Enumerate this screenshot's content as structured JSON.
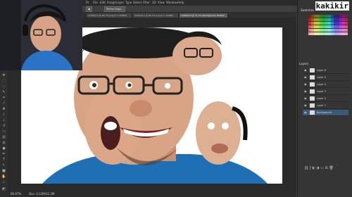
{
  "menubar": {
    "items": [
      "Ps",
      "File",
      "Edit",
      "Image",
      "Layer",
      "Type",
      "Select",
      "Filter",
      "3D",
      "View",
      "Window",
      "Help"
    ]
  },
  "options": {
    "refine_label": "Refine Edge..."
  },
  "tabs": [
    {
      "label": "Untitled-2 @ 66.7% (Layer 1, RGB/8)"
    },
    {
      "label": "Untitled-1 @ 66.7% (Layer 1, RGB/8)"
    },
    {
      "label": "Untitled-3 @ 71.7% (Background, RGB/8)"
    }
  ],
  "status": {
    "zoom": "66.67%",
    "doc": "Doc: 4.12M/31.3M"
  },
  "panels": {
    "swatches_title": "Swatches",
    "layers_title": "Layers",
    "layers": [
      {
        "name": "Layer 6"
      },
      {
        "name": "Layer 5"
      },
      {
        "name": "Layer 4"
      },
      {
        "name": "Layer 3"
      },
      {
        "name": "Layer 2"
      },
      {
        "name": "Layer 1"
      },
      {
        "name": "Background"
      }
    ]
  },
  "watermark": {
    "brand": "kakikir"
  },
  "colors": {
    "accent": "#3e5878",
    "shirt": "#1f6fb5",
    "panel_bg": "#353535"
  }
}
